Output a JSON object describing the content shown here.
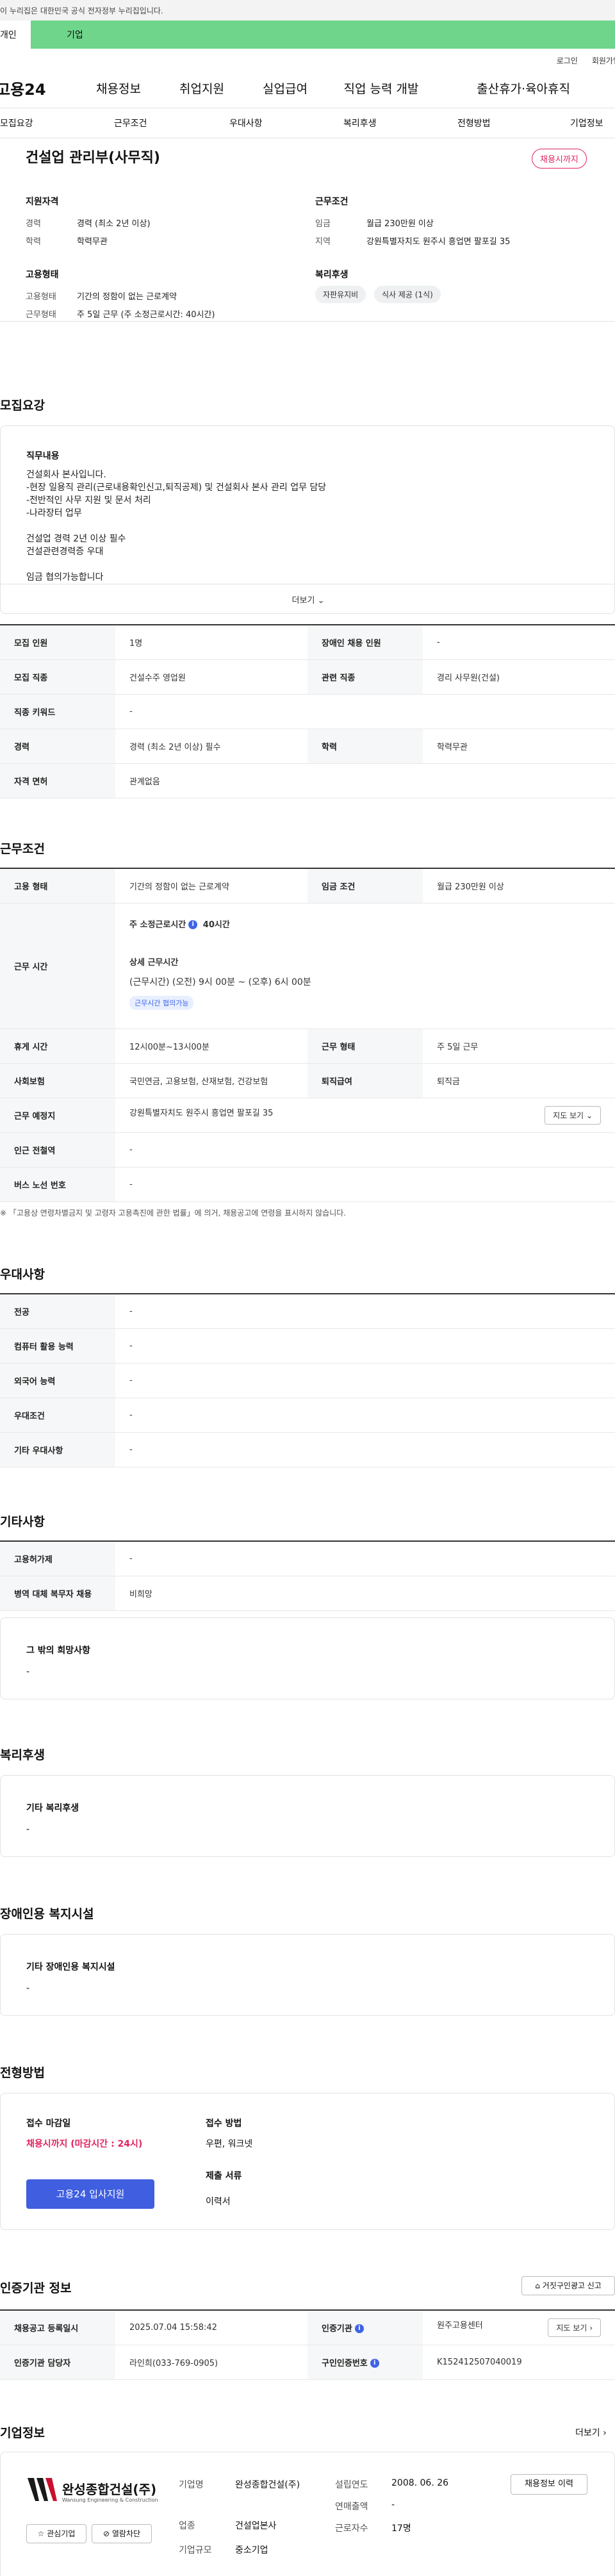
{
  "gov_bar": "이 누리집은 대한민국 공식 전자정부 누리집입니다.",
  "tabs": [
    "개인",
    "기업"
  ],
  "util": [
    "로그인",
    "회원가입"
  ],
  "gnb": {
    "logo": "고용24",
    "menus": [
      "채용정보",
      "취업지원",
      "실업급여",
      "직업 능력 개발",
      "출산휴가·육아휴직"
    ]
  },
  "anchor": [
    "모집요강",
    "근무조건",
    "우대사항",
    "복리후생",
    "전형방법",
    "기업정보"
  ],
  "title": "건설업 관리부(사무직)",
  "status_badge": "채용시까지",
  "summary": {
    "qual_title": "지원자격",
    "career_label": "경력",
    "career_value": "경력 (최소 2년 이상)",
    "edu_label": "학력",
    "edu_value": "학력무관",
    "cond_title": "근무조건",
    "wage_label": "임금",
    "wage_value": "월급 230만원 이상",
    "region_label": "지역",
    "region_value": "강원특별자치도 원주시 흥업면 팔포길 35",
    "emp_title": "고용형태",
    "emptype_label": "고용형태",
    "emptype_value": "기간의 정함이 없는 근로계약",
    "worktype_label": "근무형태",
    "worktype_value": "주 5일 근무 (주 소정근로시간: 40시간)",
    "welfare_title": "복리후생",
    "welfare_pills": [
      "자판유지비",
      "식사 제공 (1식)"
    ]
  },
  "recruit": {
    "heading": "모집요강",
    "duty_title": "직무내용",
    "duty_text": "건설회사 본사입니다.\n-현장 일용직 관리(근로내용확인신고,퇴직공제) 및 건설회사 본사 관리 업무 담당\n-전반적인 사무 지원 및 문서 처리\n-나라장터 업무\n\n건설업 경력 2년 이상 필수\n건설관련경력증 우대\n\n임금 협의가능합니다",
    "more": "더보기",
    "rows": [
      [
        "모집 인원",
        "1명",
        "장애인 채용 인원",
        "-"
      ],
      [
        "모집 직종",
        "건설수주 영업원",
        "관련 직종",
        "경리 사무원(건설)"
      ],
      [
        "직종 키워드",
        "-",
        "",
        ""
      ],
      [
        "경력",
        "경력 (최소 2년 이상) 필수",
        "학력",
        "학력무관"
      ],
      [
        "자격 면허",
        "관계없음",
        "",
        ""
      ]
    ]
  },
  "work": {
    "heading": "근무조건",
    "emptype_h": "고용 형태",
    "emptype_v": "기간의 정함이 없는 근로계약",
    "wage_h": "임금 조건",
    "wage_v": "월급 230만원 이상",
    "hours_h": "근무 시간",
    "hours_week": "주 소정근로시간",
    "hours_week_v": "40시간",
    "hours_detail_t": "상세 근무시간",
    "hours_detail_v": "(근무시간) (오전) 9시 00분 ~ (오후) 6시 00분",
    "hours_tag": "근무시간 협의가능",
    "rest_h": "휴게 시간",
    "rest_v": "12시00분~13시00분",
    "form_h": "근무 형태",
    "form_v": "주 5일 근무",
    "ins_h": "사회보험",
    "ins_v": "국민연금, 고용보험, 산재보험, 건강보험",
    "sev_h": "퇴직급여",
    "sev_v": "퇴직금",
    "place_h": "근무 예정지",
    "place_v": "강원특별자치도 원주시 흥업면 팔포길 35",
    "map_btn": "지도 보기",
    "subway_h": "인근 전철역",
    "subway_v": "-",
    "bus_h": "버스 노선 번호",
    "bus_v": "-",
    "note": "「고용상 연령차별금지 및 고령자 고용촉진에 관한 법률」에 의거, 채용공고에 연령을 표시하지 않습니다."
  },
  "pref": {
    "heading": "우대사항",
    "rows": [
      [
        "전공",
        "-"
      ],
      [
        "컴퓨터 활용 능력",
        "-"
      ],
      [
        "외국어 능력",
        "-"
      ],
      [
        "우대조건",
        "-"
      ],
      [
        "기타 우대사항",
        "-"
      ]
    ]
  },
  "etc": {
    "heading": "기타사항",
    "rows": [
      [
        "고용허가제",
        "-"
      ],
      [
        "병역 대체 복무자 채용",
        "비희망"
      ]
    ],
    "box_title": "그 밖의 희망사항",
    "box_value": "-"
  },
  "welfare": {
    "heading": "복리후생",
    "box_title": "기타 복리후생",
    "box_value": "-"
  },
  "disab": {
    "heading": "장애인용 복지시설",
    "box_title": "기타 장애인용 복지시설",
    "box_value": "-"
  },
  "process": {
    "heading": "전형방법",
    "deadline_t": "접수 마감일",
    "deadline_v": "채용시까지 (마감시간 : 24시)",
    "apply_btn": "고용24 입사지원",
    "method_t": "접수 방법",
    "method_v": "우편, 워크넷",
    "docs_t": "제출 서류",
    "docs_v": "이력서"
  },
  "agency": {
    "heading": "인증기관 정보",
    "report_btn": "거짓구인광고 신고",
    "reg_h": "채용공고 등록일시",
    "reg_v": "2025.07.04 15:58:42",
    "org_h": "인증기관",
    "org_v": "원주고용센터",
    "map_btn": "지도 보기",
    "mgr_h": "인증기관 담당자",
    "mgr_v": "라인희(033-769-0905)",
    "no_h": "구인인증번호",
    "no_v": "K152412507040019"
  },
  "company": {
    "heading": "기업정보",
    "more": "더보기",
    "logo_text": "완성종합건설(주)",
    "logo_sub": "Wansung Engineering & Construction",
    "fav_btn": "관심기업",
    "block_btn": "열람차단",
    "name_l": "기업명",
    "name_v": "완성종합건설(주)",
    "ind_l": "업종",
    "ind_v": "건설업본사",
    "size_l": "기업규모",
    "size_v": "중소기업",
    "est_l": "설립연도",
    "est_v": "2008. 06. 26",
    "sales_l": "연매출액",
    "sales_v": "-",
    "emp_l": "근로자수",
    "emp_v": "17명",
    "history_btn": "채용정보 이력"
  }
}
